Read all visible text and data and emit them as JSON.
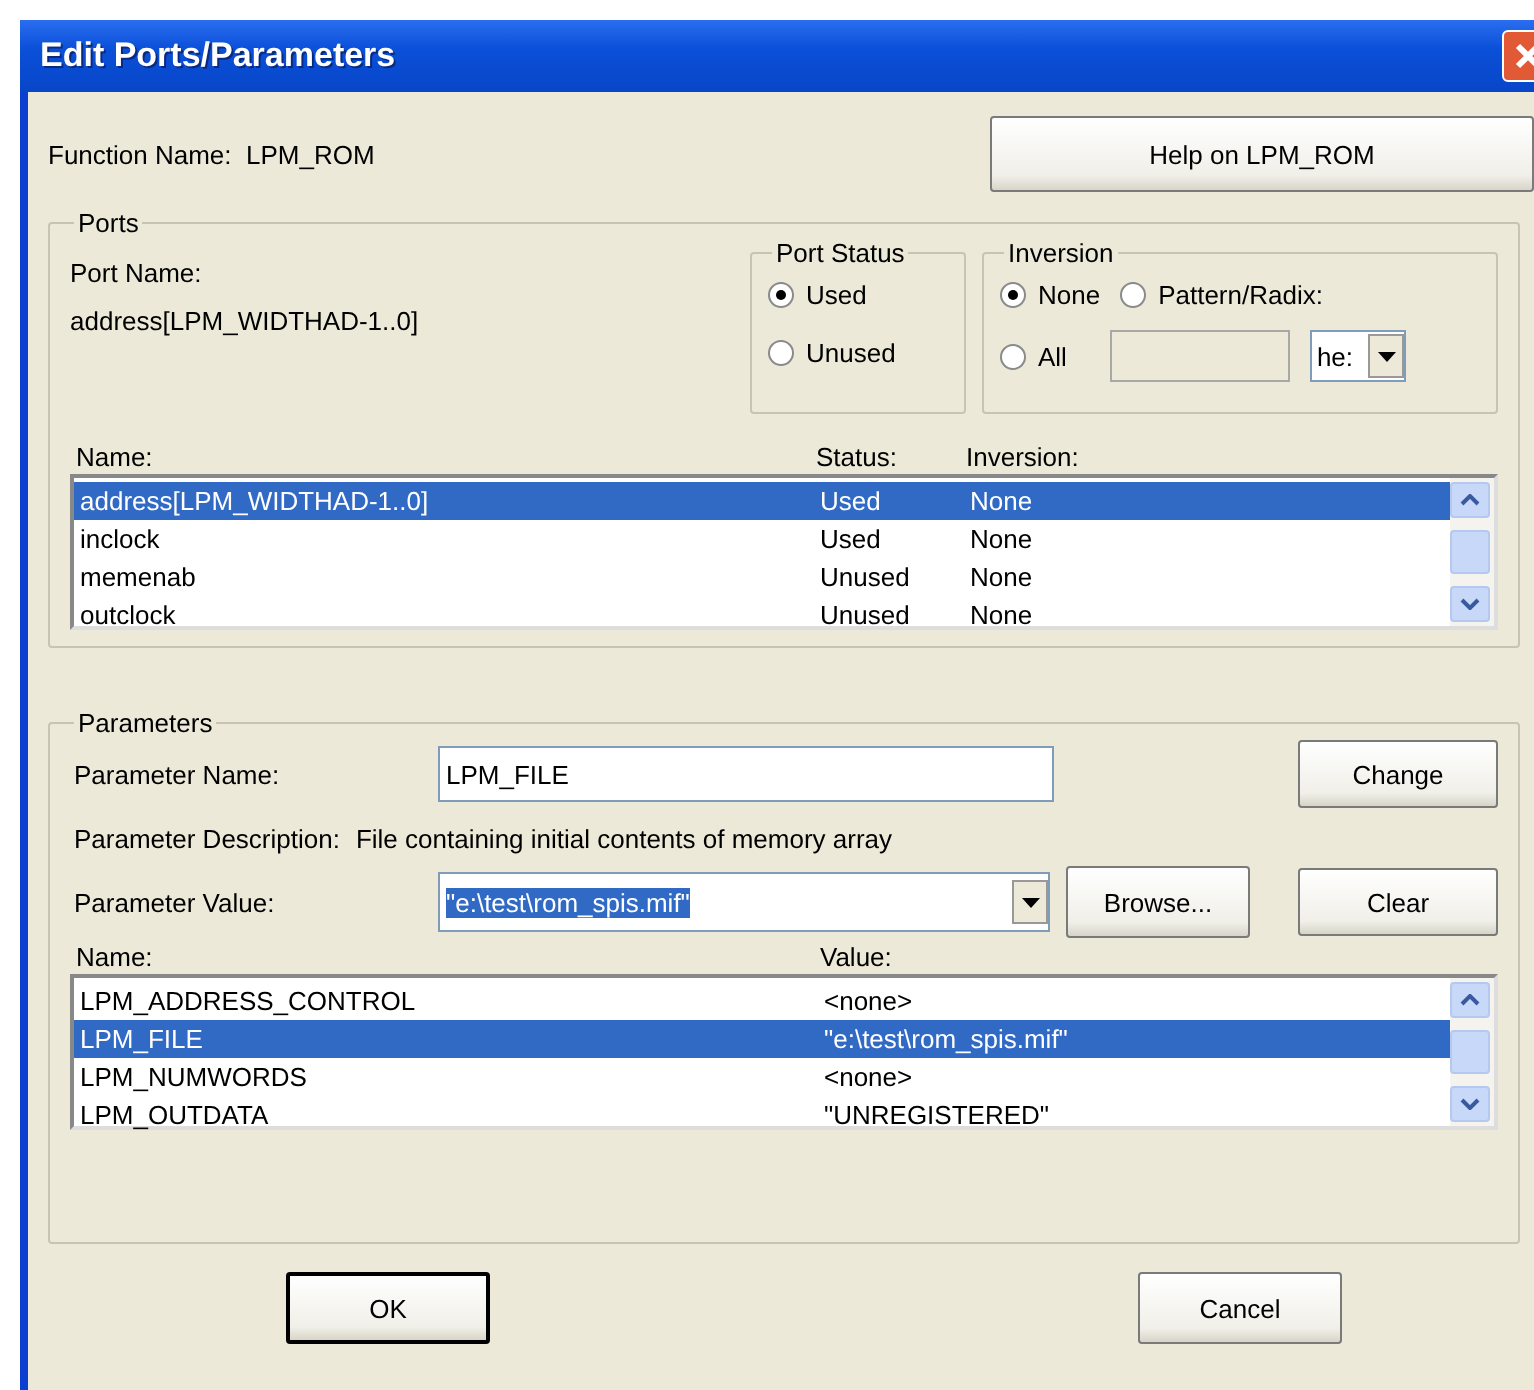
{
  "window": {
    "title": "Edit Ports/Parameters"
  },
  "function_name": {
    "label": "Function Name:",
    "value": "LPM_ROM"
  },
  "help_button": "Help on LPM_ROM",
  "ports": {
    "title": "Ports",
    "port_name_label": "Port Name:",
    "port_name": "address[LPM_WIDTHAD-1..0]",
    "port_status": {
      "title": "Port Status",
      "options": [
        {
          "label": "Used",
          "selected": true
        },
        {
          "label": "Unused",
          "selected": false
        }
      ]
    },
    "inversion": {
      "title": "Inversion",
      "options": [
        {
          "label": "None",
          "selected": true
        },
        {
          "label": "Pattern/Radix:",
          "selected": false
        },
        {
          "label": "All",
          "selected": false
        }
      ],
      "radix": "he:"
    },
    "columns": [
      "Name:",
      "Status:",
      "Inversion:"
    ],
    "rows": [
      {
        "name": "address[LPM_WIDTHAD-1..0]",
        "status": "Used",
        "inversion": "None",
        "selected": true
      },
      {
        "name": "inclock",
        "status": "Used",
        "inversion": "None",
        "selected": false
      },
      {
        "name": "memenab",
        "status": "Unused",
        "inversion": "None",
        "selected": false
      },
      {
        "name": "outclock",
        "status": "Unused",
        "inversion": "None",
        "selected": false
      }
    ]
  },
  "parameters": {
    "title": "Parameters",
    "name_label": "Parameter Name:",
    "name_value": "LPM_FILE",
    "change_button": "Change",
    "description_label": "Parameter Description:",
    "description": "File containing initial contents of memory array",
    "value_label": "Parameter Value:",
    "value": "\"e:\\test\\rom_spis.mif\"",
    "value_highlighted": true,
    "browse_button": "Browse...",
    "clear_button": "Clear",
    "columns": [
      "Name:",
      "Value:"
    ],
    "rows": [
      {
        "name": "LPM_ADDRESS_CONTROL",
        "value": "<none>",
        "selected": false
      },
      {
        "name": "LPM_FILE",
        "value": "\"e:\\test\\rom_spis.mif\"",
        "selected": true
      },
      {
        "name": "LPM_NUMWORDS",
        "value": "<none>",
        "selected": false
      },
      {
        "name": "LPM_OUTDATA",
        "value": "\"UNREGISTERED\"",
        "selected": false
      }
    ]
  },
  "buttons": [
    {
      "label": "OK",
      "default": true
    },
    {
      "label": "Cancel",
      "default": false
    }
  ]
}
